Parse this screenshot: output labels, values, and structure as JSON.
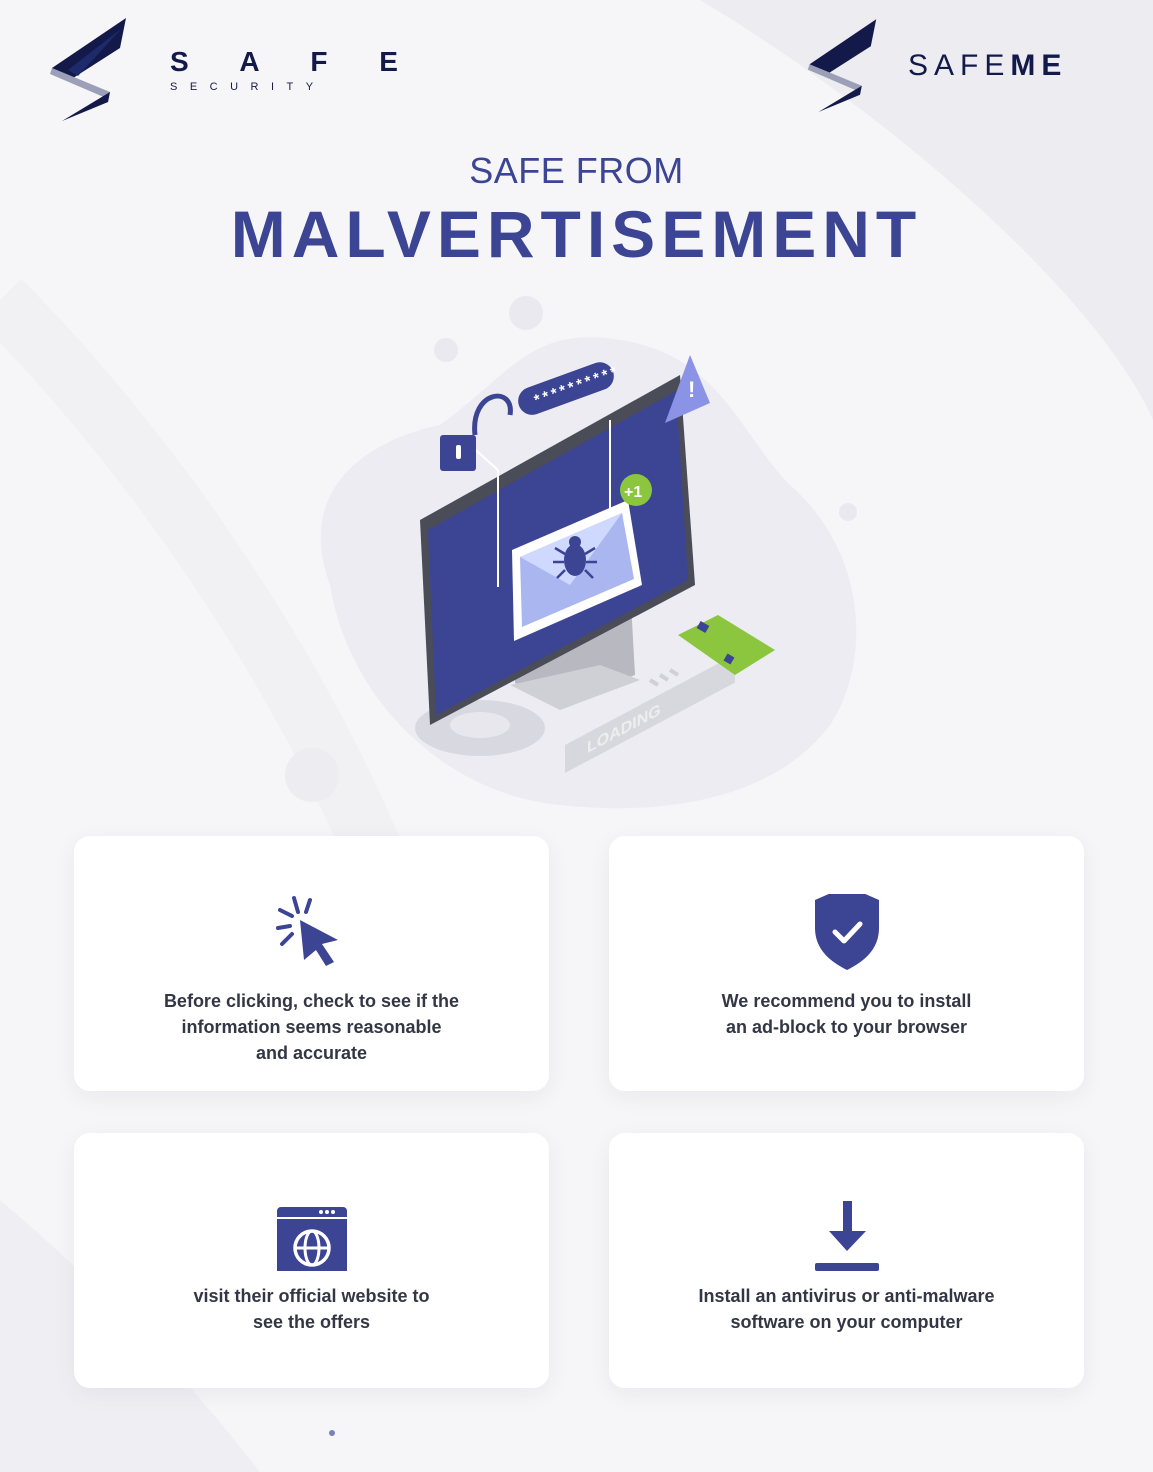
{
  "brand_left": {
    "name": "S A F E",
    "tagline": "SECURITY"
  },
  "brand_right": {
    "name_light": "SAFE",
    "name_bold": "ME"
  },
  "header": {
    "subtitle": "SAFE FROM",
    "title": "MALVERTISEMENT"
  },
  "illustration": {
    "password_text": "**********",
    "notification_badge": "+1",
    "loading_label": "LOADING",
    "warning_glyph": "!"
  },
  "tips": [
    {
      "icon": "cursor-click-icon",
      "text": "Before clicking, check to see if the\ninformation seems reasonable\nand accurate"
    },
    {
      "icon": "shield-check-icon",
      "text": "We recommend you to install\nan ad-block to your browser"
    },
    {
      "icon": "browser-globe-icon",
      "text": "visit their official website to\nsee the offers"
    },
    {
      "icon": "download-icon",
      "text": "Install an antivirus or anti-malware\nsoftware on your computer"
    }
  ],
  "colors": {
    "primary": "#3c4494",
    "navy": "#131a4a",
    "green": "#8cc63f",
    "text": "#333745"
  }
}
